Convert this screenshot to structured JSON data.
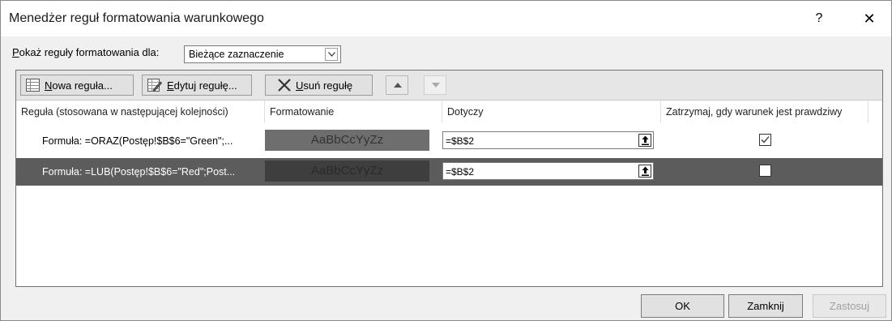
{
  "dialog": {
    "title": "Menedżer reguł formatowania warunkowego",
    "help_label": "?",
    "close_label": "✕"
  },
  "show_rules": {
    "label_first_char": "P",
    "label_rest": "okaż reguły formatowania dla:",
    "selected_value": "Bieżące zaznaczenie"
  },
  "toolbar": {
    "new_rule_first_char": "N",
    "new_rule_rest": "owa reguła...",
    "edit_rule_first_char": "E",
    "edit_rule_rest": "dytuj regułę...",
    "delete_rule_first_char": "U",
    "delete_rule_rest": "suń regułę"
  },
  "columns": {
    "rule": "Reguła (stosowana w następującej kolejności)",
    "format": "Formatowanie",
    "applies_to": "Dotyczy",
    "stop_if_true": "Zatrzymaj, gdy warunek jest prawdziwy"
  },
  "rules": [
    {
      "text": "Formuła: =ORAZ(Postęp!$B$6=\"Green\";...",
      "preview": "AaBbCcYyZz",
      "applies_to": "=$B$2",
      "stop_if_true": true,
      "selected": false
    },
    {
      "text": "Formuła: =LUB(Postęp!$B$6=\"Red\";Post...",
      "preview": "AaBbCcYyZz",
      "applies_to": "=$B$2",
      "stop_if_true": false,
      "selected": true
    }
  ],
  "footer": {
    "ok_label": "OK",
    "close_label": "Zamknij",
    "apply_label": "Zastosuj"
  }
}
